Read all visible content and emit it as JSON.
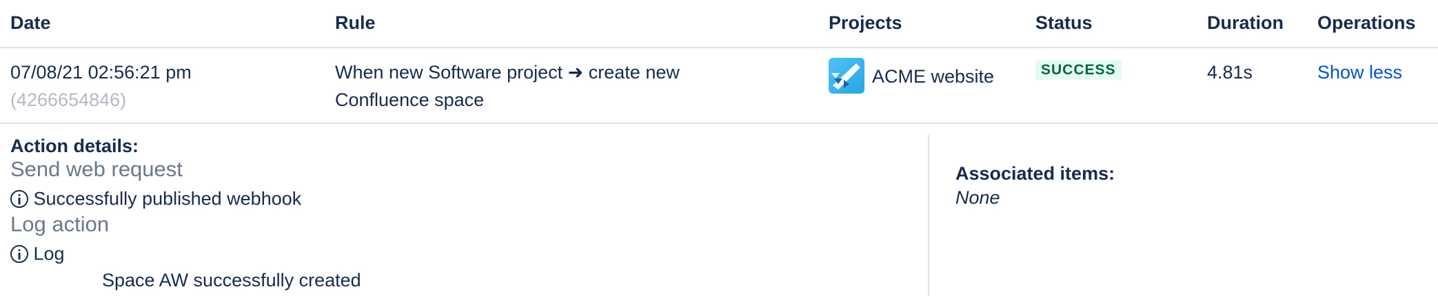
{
  "table": {
    "headers": {
      "date": "Date",
      "rule": "Rule",
      "projects": "Projects",
      "status": "Status",
      "duration": "Duration",
      "operations": "Operations"
    },
    "row": {
      "date": "07/08/21 02:56:21 pm",
      "id": "(4266654846)",
      "rule_line1": "When new Software project ➜ create new",
      "rule_line2": "Confluence space",
      "project_name": "ACME website",
      "project_icon": "rocket-icon",
      "status": "SUCCESS",
      "duration": "4.81s",
      "operation": "Show less"
    }
  },
  "details": {
    "action_details_label": "Action details:",
    "actions": [
      {
        "title": "Send web request",
        "message": "Successfully published webhook",
        "icon": "info-icon"
      },
      {
        "title": "Log action",
        "message": "Log",
        "icon": "info-icon",
        "log_text": "Space AW successfully created"
      }
    ],
    "associated_label": "Associated items:",
    "associated_value": "None"
  },
  "colors": {
    "text": "#172b4d",
    "muted": "#b3bac5",
    "link": "#0052cc",
    "success_bg": "#e3fcef",
    "success_text": "#006644",
    "action_title": "#6b778c",
    "divider": "#dfe1e6"
  }
}
